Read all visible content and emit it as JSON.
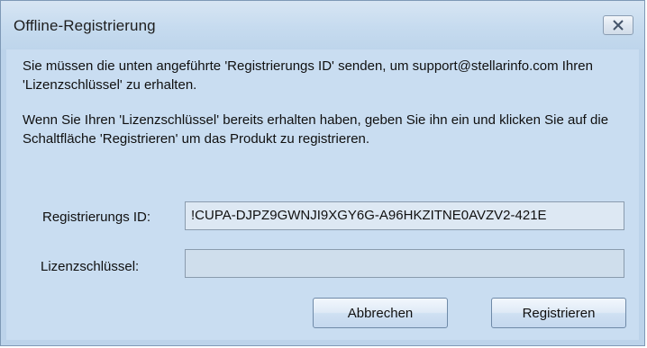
{
  "window": {
    "title": "Offline-Registrierung",
    "close_icon": "close-x-icon"
  },
  "messages": {
    "line1": "Sie müssen die unten angeführte 'Registrierungs ID' senden, um support@stellarinfo.com Ihren 'Lizenzschlüssel' zu erhalten.",
    "line2": "Wenn Sie Ihren 'Lizenzschlüssel' bereits erhalten haben, geben Sie ihn ein und klicken Sie auf die Schaltfläche 'Registrieren' um das Produkt zu registrieren."
  },
  "form": {
    "registration_id_label": "Registrierungs ID:",
    "registration_id_value": "!CUPA-DJPZ9GWNJI9XGY6G-A96HKZITNE0AVZV2-421E",
    "license_key_label": "Lizenzschlüssel:",
    "license_key_value": ""
  },
  "buttons": {
    "cancel": "Abbrechen",
    "register": "Registrieren"
  },
  "colors": {
    "background": "#c9ddf1",
    "border": "#7e99b6"
  }
}
